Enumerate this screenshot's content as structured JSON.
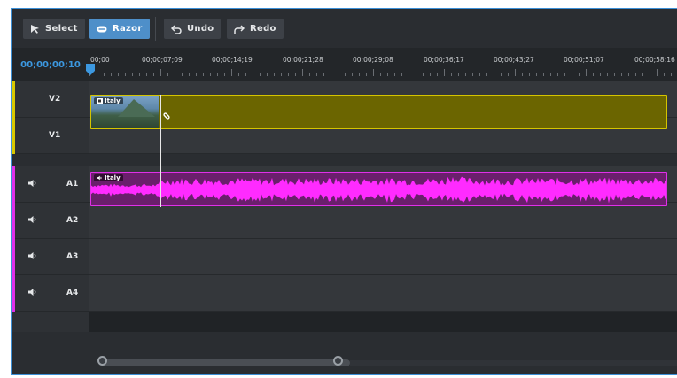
{
  "toolbar": {
    "select_label": "Select",
    "razor_label": "Razor",
    "undo_label": "Undo",
    "redo_label": "Redo",
    "active_tool": "Razor"
  },
  "ruler": {
    "current_time": "00;00;00;10",
    "ticks": [
      "00;00",
      "00;00;07;09",
      "00;00;14;19",
      "00;00;21;28",
      "00;00;29;08",
      "00;00;36;17",
      "00;00;43;27",
      "00;00;51;07",
      "00;00;58;16"
    ]
  },
  "tracks": [
    {
      "name": "V2",
      "kind": "video",
      "color": "#d8c800"
    },
    {
      "name": "V1",
      "kind": "video",
      "color": "#d8c800"
    },
    {
      "name": "A1",
      "kind": "audio",
      "color": "#e030e8"
    },
    {
      "name": "A2",
      "kind": "audio",
      "color": "#e030e8"
    },
    {
      "name": "A3",
      "kind": "audio",
      "color": "#e030e8"
    },
    {
      "name": "A4",
      "kind": "audio",
      "color": "#e030e8"
    }
  ],
  "clips": {
    "video_label": "Italy",
    "audio_label": "Italy"
  },
  "colors": {
    "accent": "#4e8fc9",
    "video_clip": "#6b6500",
    "audio_clip": "#6a1f6c",
    "waveform": "#ff2bff"
  },
  "icons": {
    "select": "cursor-arrow-icon",
    "razor": "razor-icon",
    "undo": "undo-icon",
    "redo": "redo-icon",
    "speaker": "speaker-icon",
    "link": "link-icon"
  }
}
